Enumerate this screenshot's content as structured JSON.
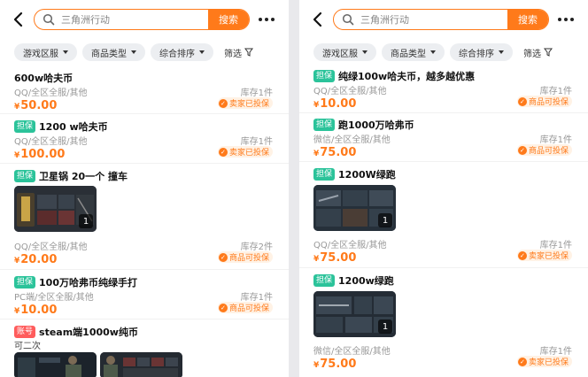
{
  "colors": {
    "accent": "#ff7a1a",
    "guarantee": "#2bc39a",
    "account": "#ff5c5c"
  },
  "search": {
    "value": "三角洲行动",
    "button": "搜索"
  },
  "filters": {
    "chips": [
      "游戏区服",
      "商品类型",
      "综合排序"
    ],
    "screen": "筛选"
  },
  "left_items": [
    {
      "badge": "",
      "title": "600w哈夫币",
      "sub": "QQ/全区全服/其他",
      "stock": "库存1件",
      "currency": "¥",
      "price": "50.00",
      "guard": "卖家已投保"
    },
    {
      "badge": "担保",
      "title": "1200 w哈夫币",
      "sub": "QQ/全区全服/其他",
      "stock": "库存1件",
      "currency": "¥",
      "price": "100.00",
      "guard": "卖家已投保"
    },
    {
      "badge": "担保",
      "title": "卫星锅 20一个 撞车",
      "sub": "QQ/全区全服/其他",
      "stock": "库存2件",
      "currency": "¥",
      "price": "20.00",
      "guard": "商品可投保",
      "image_count": "1"
    },
    {
      "badge": "担保",
      "title": "100万哈弗币纯绿手打",
      "sub": "PC端/全区全服/其他",
      "stock": "库存1件",
      "currency": "¥",
      "price": "10.00",
      "guard": "商品可投保"
    },
    {
      "badge": "账号",
      "title": "steam端1000w纯币",
      "desc": "可二次"
    }
  ],
  "right_items": [
    {
      "badge": "担保",
      "title": "纯绿100w哈夫币，越多越优惠",
      "sub": "QQ/全区全服/其他",
      "stock": "库存1件",
      "currency": "¥",
      "price": "10.00",
      "guard": "商品可投保"
    },
    {
      "badge": "担保",
      "title": "跑1000万哈弗币",
      "sub": "微信/全区全服/其他",
      "stock": "库存1件",
      "currency": "¥",
      "price": "75.00",
      "guard": "商品可投保"
    },
    {
      "badge": "担保",
      "title": "1200W绿跑",
      "sub": "QQ/全区全服/其他",
      "stock": "库存1件",
      "currency": "¥",
      "price": "75.00",
      "guard": "卖家已投保",
      "image_count": "1"
    },
    {
      "badge": "担保",
      "title": "1200w绿跑",
      "sub": "微信/全区全服/其他",
      "stock": "库存1件",
      "currency": "¥",
      "price": "75.00",
      "guard": "卖家已投保",
      "image_count": "1"
    }
  ],
  "icons": {
    "back": "chevron-left-icon",
    "search": "search-icon",
    "more": "more-dots-icon",
    "filter": "funnel-icon",
    "shield": "shield-icon"
  }
}
